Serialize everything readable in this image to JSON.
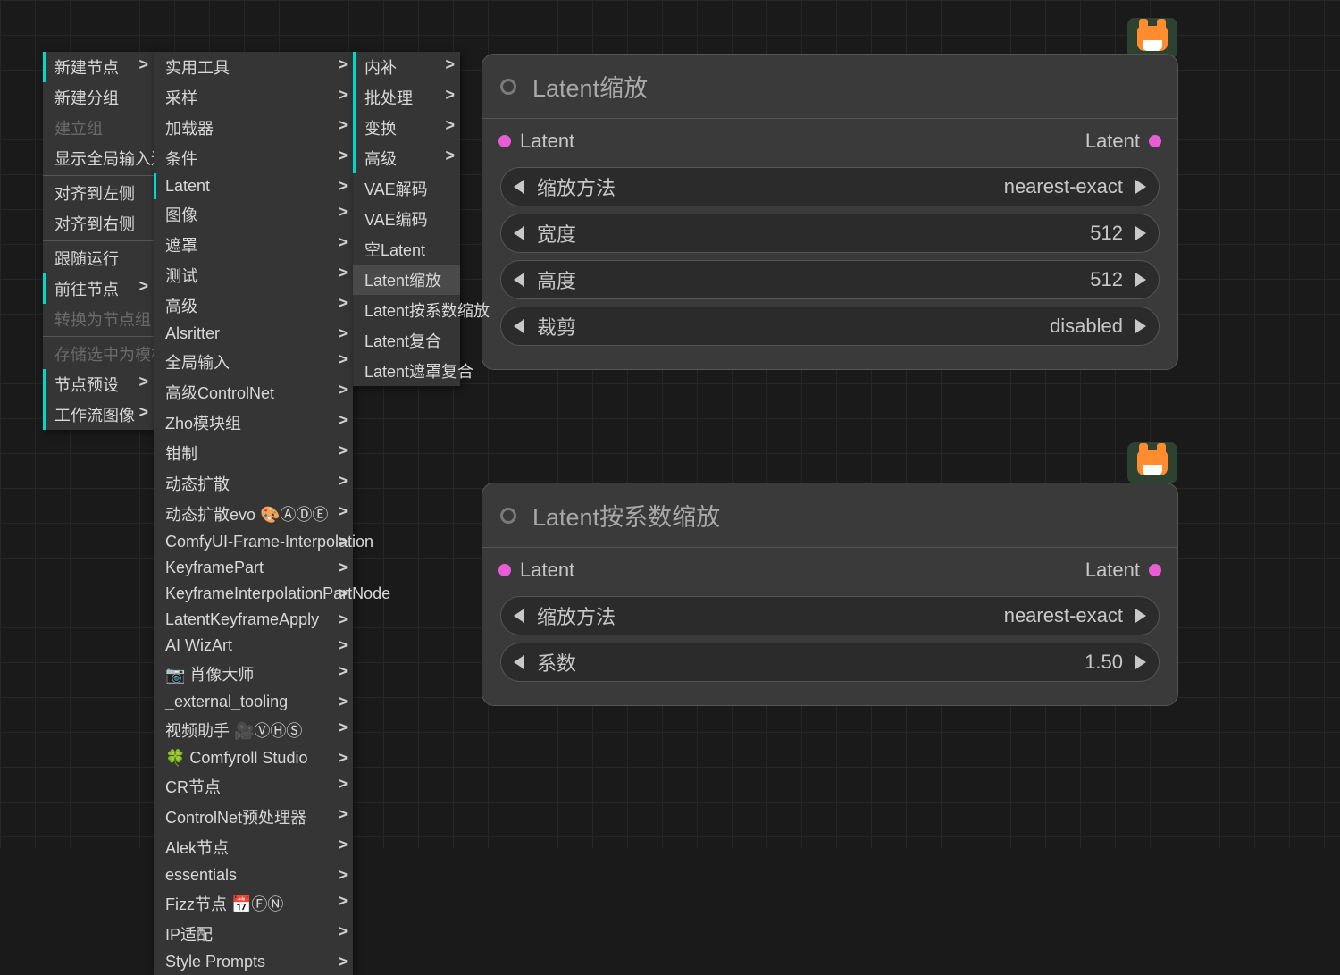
{
  "menu1": {
    "items": [
      {
        "label": "新建节点",
        "arrow": true,
        "hl": true
      },
      {
        "label": "新建分组",
        "arrow": false
      },
      {
        "label": "建立组",
        "arrow": false,
        "disabled": true
      },
      {
        "label": "显示全局输入连线",
        "arrow": false,
        "sep": true
      },
      {
        "label": "对齐到左侧",
        "arrow": false
      },
      {
        "label": "对齐到右侧",
        "arrow": false,
        "sep": true
      },
      {
        "label": "跟随运行",
        "arrow": false
      },
      {
        "label": "前往节点",
        "arrow": true,
        "hl": true
      },
      {
        "label": "转换为节点组",
        "arrow": false,
        "disabled": true,
        "sep": true
      },
      {
        "label": "存储选中为模板",
        "arrow": false,
        "disabled": true
      },
      {
        "label": "节点预设",
        "arrow": true,
        "hl": true
      },
      {
        "label": "工作流图像",
        "arrow": true,
        "hl": true
      }
    ]
  },
  "menu2": {
    "items": [
      {
        "label": "实用工具"
      },
      {
        "label": "采样"
      },
      {
        "label": "加载器"
      },
      {
        "label": "条件"
      },
      {
        "label": "Latent",
        "hl": true
      },
      {
        "label": "图像"
      },
      {
        "label": "遮罩"
      },
      {
        "label": "测试"
      },
      {
        "label": "高级"
      },
      {
        "label": "Alsritter"
      },
      {
        "label": "全局输入"
      },
      {
        "label": "高级ControlNet"
      },
      {
        "label": "Zho模块组"
      },
      {
        "label": "钳制"
      },
      {
        "label": "动态扩散"
      },
      {
        "label": "动态扩散evo 🎨ⒶⒹⒺ"
      },
      {
        "label": "ComfyUI-Frame-Interpolation"
      },
      {
        "label": "KeyframePart"
      },
      {
        "label": "KeyframeInterpolationPartNode"
      },
      {
        "label": "LatentKeyframeApply"
      },
      {
        "label": "AI WizArt"
      },
      {
        "label": "📷 肖像大师"
      },
      {
        "label": "_external_tooling"
      },
      {
        "label": "视频助手 🎥ⓋⒽⓈ"
      },
      {
        "label": "🍀 Comfyroll Studio"
      },
      {
        "label": "CR节点"
      },
      {
        "label": "ControlNet预处理器"
      },
      {
        "label": "Alek节点"
      },
      {
        "label": "essentials"
      },
      {
        "label": "Fizz节点 📅ⒻⓃ"
      },
      {
        "label": "IP适配"
      },
      {
        "label": "Style Prompts"
      }
    ]
  },
  "menu3": {
    "items": [
      {
        "label": "内补",
        "arrow": true,
        "hl": true
      },
      {
        "label": "批处理",
        "arrow": true,
        "hl": true
      },
      {
        "label": "变换",
        "arrow": true,
        "hl": true
      },
      {
        "label": "高级",
        "arrow": true,
        "hl": true
      },
      {
        "label": "VAE解码"
      },
      {
        "label": "VAE编码"
      },
      {
        "label": "空Latent"
      },
      {
        "label": "Latent缩放",
        "selected": true
      },
      {
        "label": "Latent按系数缩放"
      },
      {
        "label": "Latent复合"
      },
      {
        "label": "Latent遮罩复合"
      }
    ]
  },
  "node1": {
    "title": "Latent缩放",
    "input": "Latent",
    "output": "Latent",
    "widgets": [
      {
        "label": "缩放方法",
        "value": "nearest-exact"
      },
      {
        "label": "宽度",
        "value": "512"
      },
      {
        "label": "高度",
        "value": "512"
      },
      {
        "label": "裁剪",
        "value": "disabled"
      }
    ]
  },
  "node2": {
    "title": "Latent按系数缩放",
    "input": "Latent",
    "output": "Latent",
    "widgets": [
      {
        "label": "缩放方法",
        "value": "nearest-exact"
      },
      {
        "label": "系数",
        "value": "1.50"
      }
    ]
  }
}
